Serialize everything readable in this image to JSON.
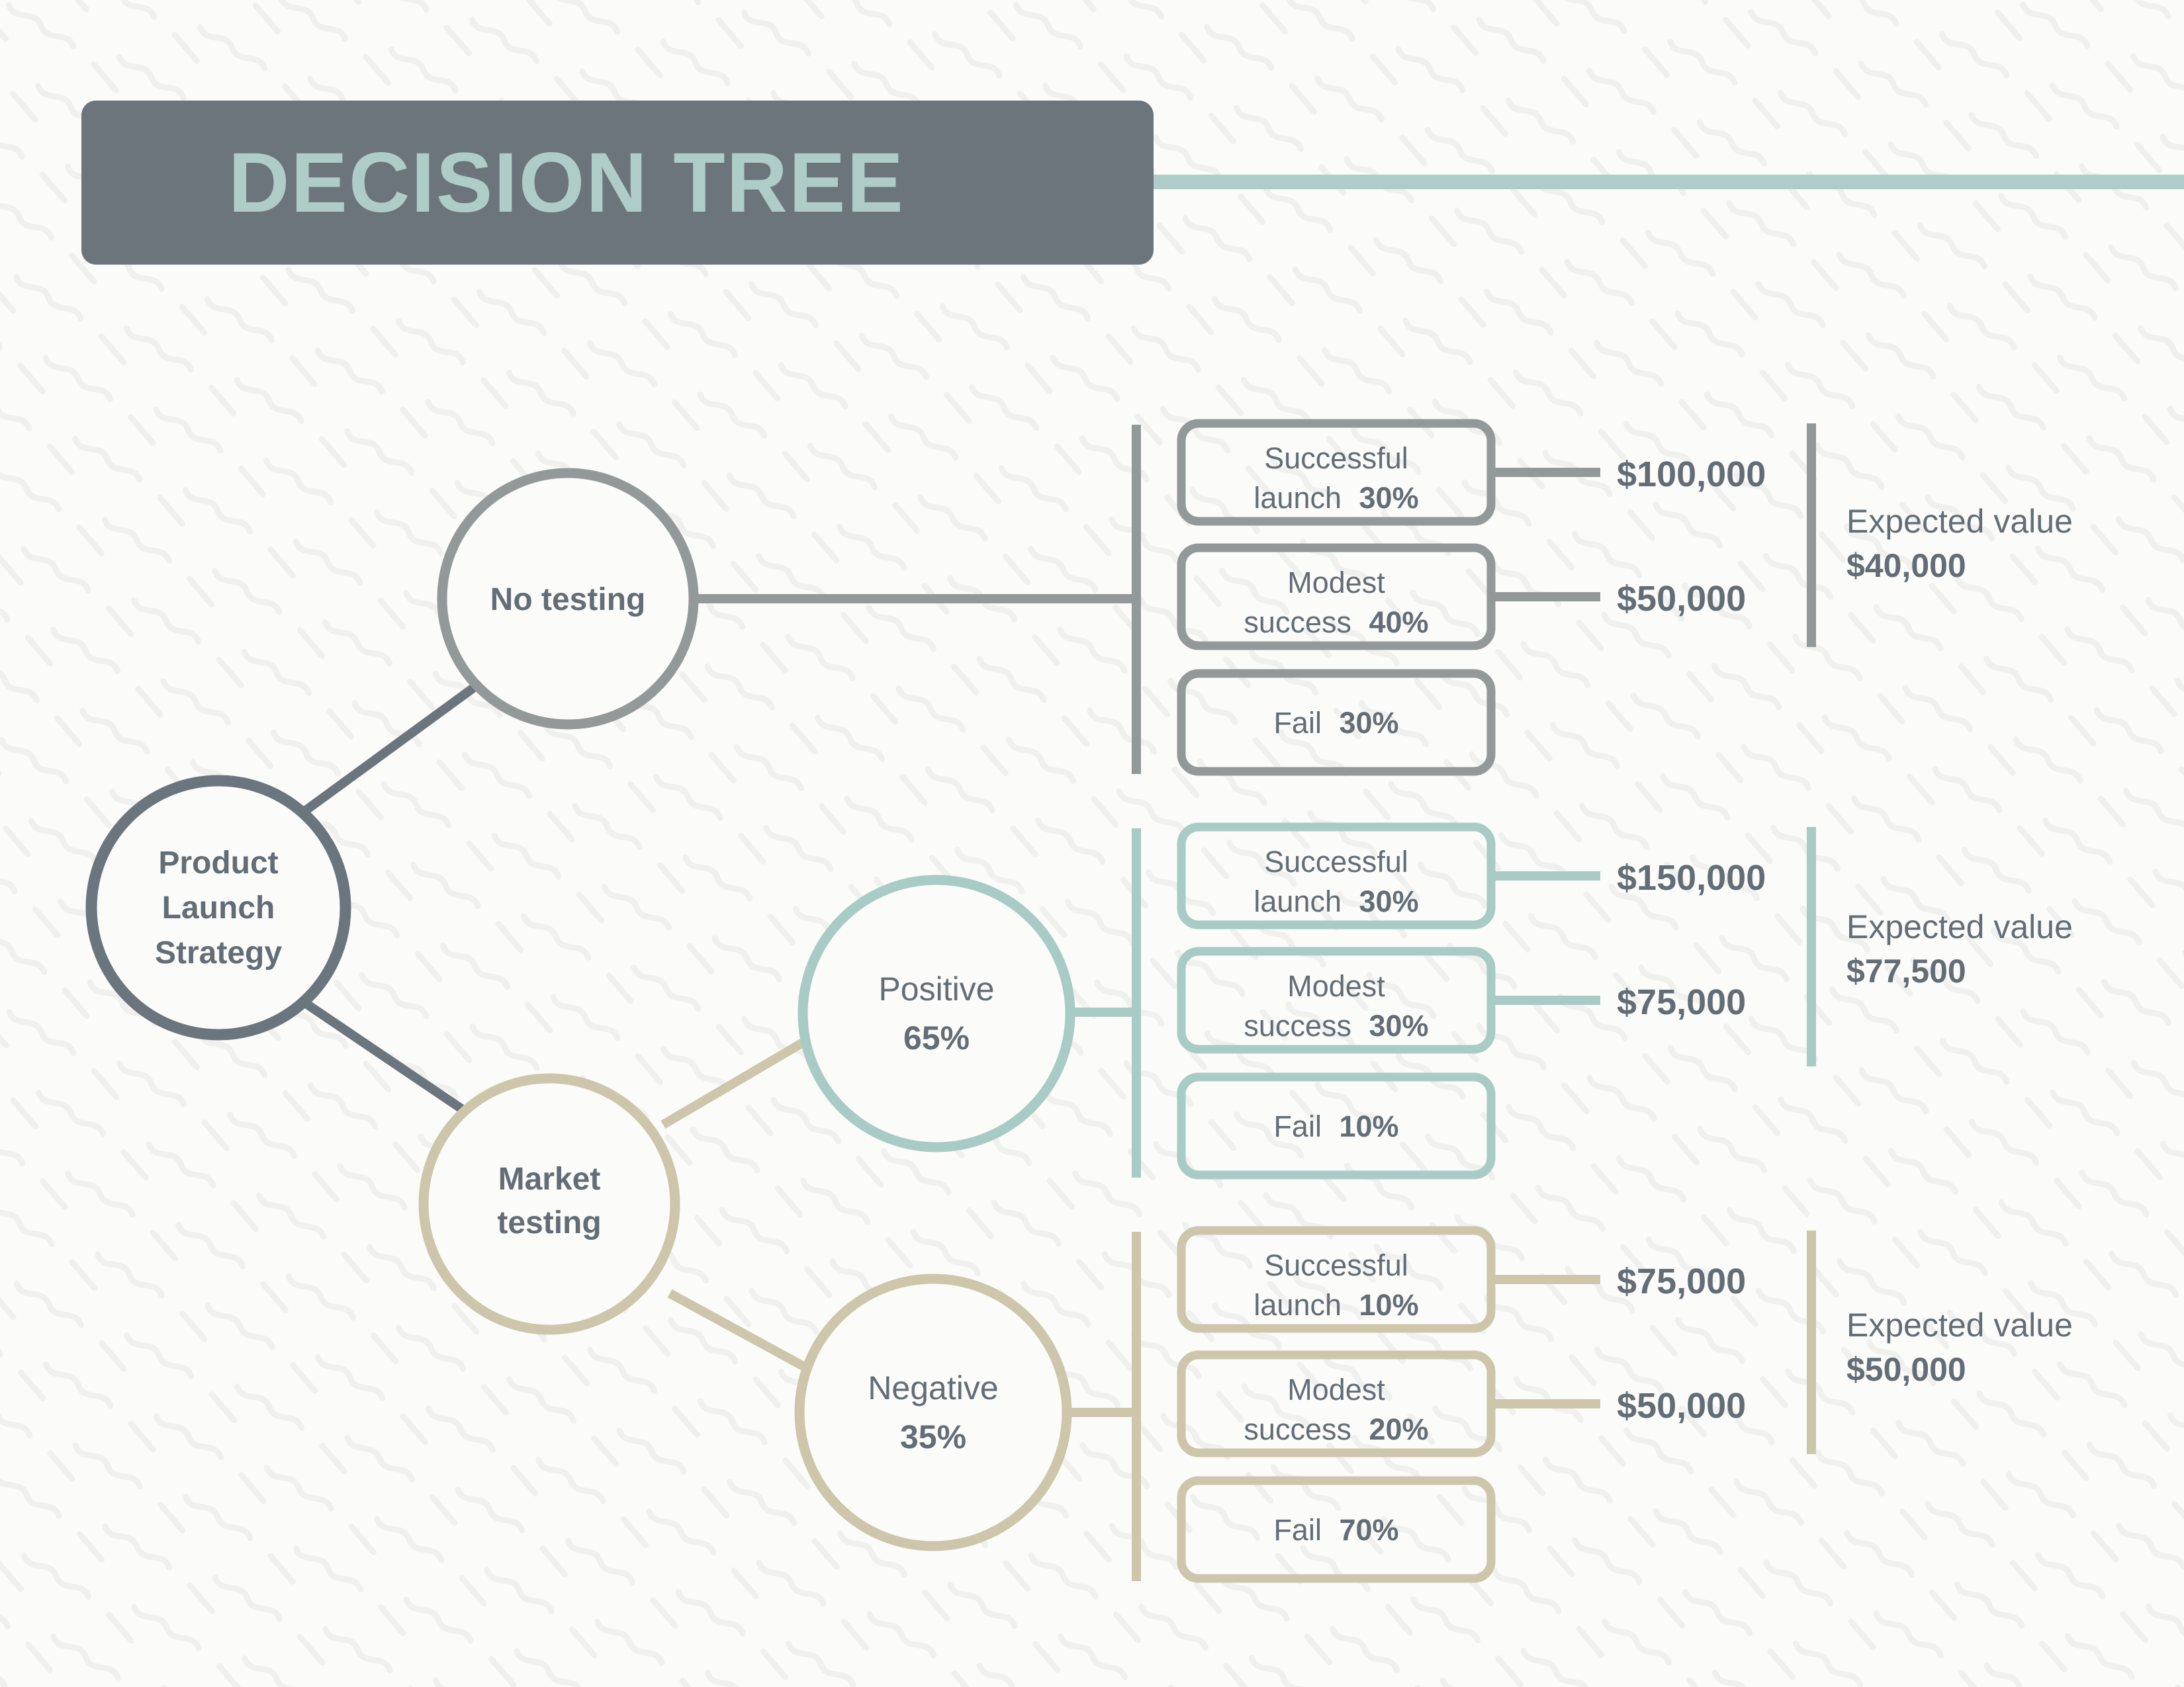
{
  "header": {
    "title": "DECISION TREE",
    "title_bar_color": "#6d757c",
    "title_text_color": "#aecdc8",
    "accent_rule_color": "#aecdc8"
  },
  "colors": {
    "background": "#fbfbfa",
    "pattern": "#f0f0ef",
    "root": "#6a757e",
    "gray": "#939899",
    "teal": "#a8cbc5",
    "tan": "#cdc6ab",
    "text": "#626d75"
  },
  "root_node": {
    "label_lines": [
      "Product",
      "Launch",
      "Strategy"
    ]
  },
  "branches": [
    {
      "id": "no-testing",
      "node_label": "No testing",
      "node_prob": "",
      "accent": "#939899",
      "outcomes": [
        {
          "label": "Successful",
          "label2": "launch",
          "pct": "30%",
          "value": "$100,000"
        },
        {
          "label": "Modest",
          "label2": "success",
          "pct": "40%",
          "value": "$50,000"
        },
        {
          "label": "Fail",
          "label2": "",
          "pct": "30%",
          "value": ""
        }
      ],
      "expected_value_label": "Expected value",
      "expected_value": "$40,000"
    },
    {
      "id": "positive",
      "node_label": "Positive",
      "node_prob": "65%",
      "accent": "#a8cbc5",
      "outcomes": [
        {
          "label": "Successful",
          "label2": "launch",
          "pct": "30%",
          "value": "$150,000"
        },
        {
          "label": "Modest",
          "label2": "success",
          "pct": "30%",
          "value": "$75,000"
        },
        {
          "label": "Fail",
          "label2": "",
          "pct": "10%",
          "value": ""
        }
      ],
      "expected_value_label": "Expected value",
      "expected_value": "$77,500"
    },
    {
      "id": "negative",
      "node_label": "Negative",
      "node_prob": "35%",
      "accent": "#cdc6ab",
      "outcomes": [
        {
          "label": "Successful",
          "label2": "launch",
          "pct": "10%",
          "value": "$75,000"
        },
        {
          "label": "Modest",
          "label2": "success",
          "pct": "20%",
          "value": "$50,000"
        },
        {
          "label": "Fail",
          "label2": "",
          "pct": "70%",
          "value": ""
        }
      ],
      "expected_value_label": "Expected value",
      "expected_value": "$50,000"
    }
  ],
  "market_testing_node": {
    "label_lines": [
      "Market",
      "testing"
    ],
    "accent": "#cdc6ab"
  },
  "chart_data": {
    "type": "table",
    "title": "DECISION TREE",
    "decision": "Product Launch Strategy",
    "alternatives": [
      {
        "name": "No testing",
        "probability": null,
        "expected_value": 40000,
        "outcomes": [
          {
            "outcome": "Successful launch",
            "probability": 0.3,
            "payoff": 100000
          },
          {
            "outcome": "Modest success",
            "probability": 0.4,
            "payoff": 50000
          },
          {
            "outcome": "Fail",
            "probability": 0.3,
            "payoff": null
          }
        ]
      },
      {
        "name": "Market testing / Positive",
        "probability": 0.65,
        "expected_value": 77500,
        "outcomes": [
          {
            "outcome": "Successful launch",
            "probability": 0.3,
            "payoff": 150000
          },
          {
            "outcome": "Modest success",
            "probability": 0.3,
            "payoff": 75000
          },
          {
            "outcome": "Fail",
            "probability": 0.1,
            "payoff": null
          }
        ]
      },
      {
        "name": "Market testing / Negative",
        "probability": 0.35,
        "expected_value": 50000,
        "outcomes": [
          {
            "outcome": "Successful launch",
            "probability": 0.1,
            "payoff": 75000
          },
          {
            "outcome": "Modest success",
            "probability": 0.2,
            "payoff": 50000
          },
          {
            "outcome": "Fail",
            "probability": 0.7,
            "payoff": null
          }
        ]
      }
    ]
  }
}
